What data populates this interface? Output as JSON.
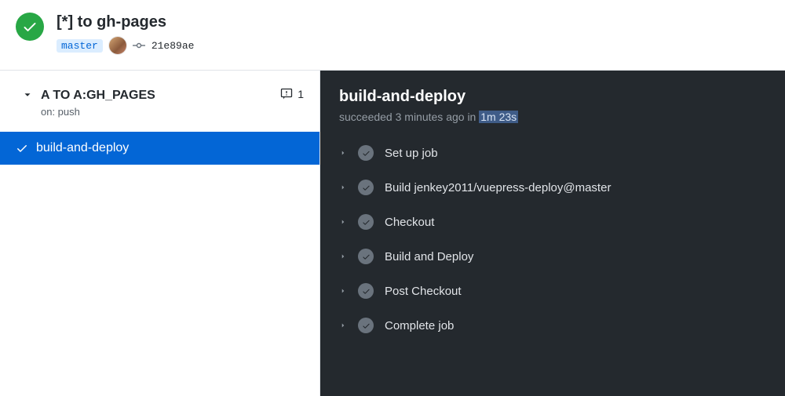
{
  "run": {
    "title": "[*] to gh-pages",
    "branch": "master",
    "commit_sha": "21e89ae"
  },
  "workflow": {
    "name": "A TO A:GH_PAGES",
    "trigger": "on: push",
    "annotation_count": "1",
    "jobs": [
      {
        "name": "build-and-deploy",
        "selected": true
      }
    ]
  },
  "job": {
    "title": "build-and-deploy",
    "status_prefix": "succeeded 3 minutes ago in ",
    "duration": "1m 23s",
    "steps": [
      {
        "name": "Set up job"
      },
      {
        "name": "Build jenkey2011/vuepress-deploy@master"
      },
      {
        "name": "Checkout"
      },
      {
        "name": "Build and Deploy"
      },
      {
        "name": "Post Checkout"
      },
      {
        "name": "Complete job"
      }
    ]
  }
}
